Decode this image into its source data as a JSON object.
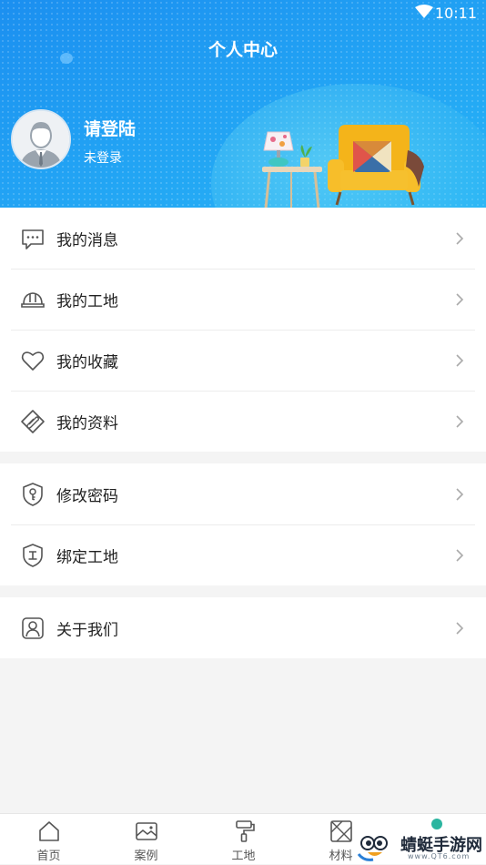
{
  "status_bar": {
    "time": "10:11"
  },
  "header": {
    "title": "个人中心",
    "login_title": "请登陆",
    "login_subtitle": "未登录"
  },
  "sections": [
    {
      "items": [
        {
          "label": "我的消息",
          "icon": "message-icon"
        },
        {
          "label": "我的工地",
          "icon": "helmet-icon"
        },
        {
          "label": "我的收藏",
          "icon": "heart-icon"
        },
        {
          "label": "我的资料",
          "icon": "paperclip-icon"
        }
      ]
    },
    {
      "items": [
        {
          "label": "修改密码",
          "icon": "shield-key-icon"
        },
        {
          "label": "绑定工地",
          "icon": "shield-site-icon"
        }
      ]
    },
    {
      "items": [
        {
          "label": "关于我们",
          "icon": "user-icon"
        }
      ]
    }
  ],
  "tabbar": [
    {
      "label": "首页",
      "icon": "home-icon"
    },
    {
      "label": "案例",
      "icon": "image-icon"
    },
    {
      "label": "工地",
      "icon": "paint-roller-icon"
    },
    {
      "label": "材料",
      "icon": "material-icon"
    }
  ],
  "watermark": {
    "text": "蜻蜓手游网",
    "sub": "www.QT6.com"
  },
  "colors": {
    "header_blue": "#1b8ff0",
    "sofa_yellow": "#f4b41a"
  }
}
